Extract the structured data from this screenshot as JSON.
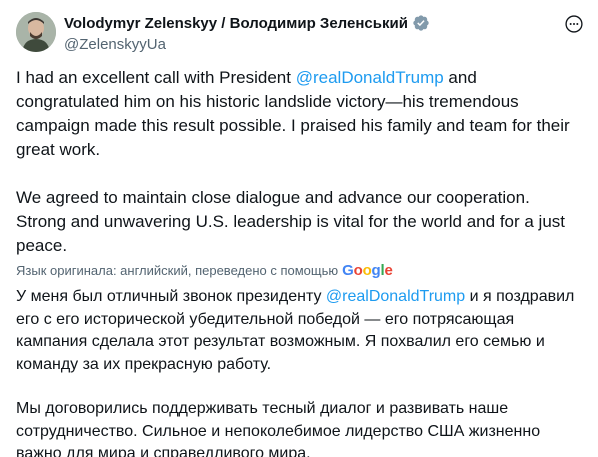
{
  "author": {
    "display_name": "Volodymyr Zelenskyy / Володимир Зеленський",
    "handle": "@ZelenskyyUa",
    "avatar_icon": "person-avatar",
    "verified_icon": "verified-badge-icon",
    "verified_color": "#829aab"
  },
  "tweet": {
    "original": {
      "p1_before": "I had an excellent call with President ",
      "p1_mention": "@realDonaldTrump",
      "p1_after": " and congratulated him on his historic landslide victory—his tremendous campaign made this result possible. I praised his family and team for their great work.",
      "p2": "We agreed to maintain close dialogue and advance our cooperation. Strong and unwavering U.S. leadership is vital for the world and for a just peace."
    },
    "translation_note": "Язык оригинала: английский, переведено с помощью",
    "translation_provider": "Google",
    "translated": {
      "p1_before": "У меня был отличный звонок президенту ",
      "p1_mention": "@realDonaldTrump",
      "p1_after": " и я поздравил его с его исторической убедительной победой — его потрясающая кампания сделала этот результат возможным. Я похвалил его семью и команду за их прекрасную работу.",
      "p2": "Мы договорились поддерживать тесный диалог и развивать наше сотрудничество. Сильное и непоколебимое лидерство США жизненно важно для мира и справедливого мира."
    }
  },
  "colors": {
    "mention": "#1d9bf0",
    "secondary_text": "#536471",
    "primary_text": "#0f1419"
  }
}
